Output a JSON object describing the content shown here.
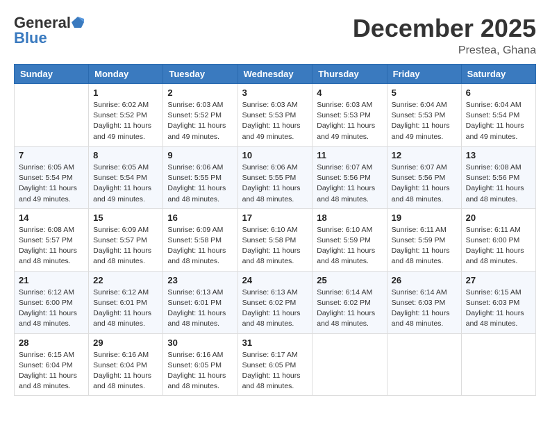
{
  "logo": {
    "general": "General",
    "blue": "Blue"
  },
  "title": "December 2025",
  "location": "Prestea, Ghana",
  "weekdays": [
    "Sunday",
    "Monday",
    "Tuesday",
    "Wednesday",
    "Thursday",
    "Friday",
    "Saturday"
  ],
  "weeks": [
    [
      {
        "day": "",
        "info": ""
      },
      {
        "day": "1",
        "info": "Sunrise: 6:02 AM\nSunset: 5:52 PM\nDaylight: 11 hours\nand 49 minutes."
      },
      {
        "day": "2",
        "info": "Sunrise: 6:03 AM\nSunset: 5:52 PM\nDaylight: 11 hours\nand 49 minutes."
      },
      {
        "day": "3",
        "info": "Sunrise: 6:03 AM\nSunset: 5:53 PM\nDaylight: 11 hours\nand 49 minutes."
      },
      {
        "day": "4",
        "info": "Sunrise: 6:03 AM\nSunset: 5:53 PM\nDaylight: 11 hours\nand 49 minutes."
      },
      {
        "day": "5",
        "info": "Sunrise: 6:04 AM\nSunset: 5:53 PM\nDaylight: 11 hours\nand 49 minutes."
      },
      {
        "day": "6",
        "info": "Sunrise: 6:04 AM\nSunset: 5:54 PM\nDaylight: 11 hours\nand 49 minutes."
      }
    ],
    [
      {
        "day": "7",
        "info": "Sunrise: 6:05 AM\nSunset: 5:54 PM\nDaylight: 11 hours\nand 49 minutes."
      },
      {
        "day": "8",
        "info": "Sunrise: 6:05 AM\nSunset: 5:54 PM\nDaylight: 11 hours\nand 49 minutes."
      },
      {
        "day": "9",
        "info": "Sunrise: 6:06 AM\nSunset: 5:55 PM\nDaylight: 11 hours\nand 48 minutes."
      },
      {
        "day": "10",
        "info": "Sunrise: 6:06 AM\nSunset: 5:55 PM\nDaylight: 11 hours\nand 48 minutes."
      },
      {
        "day": "11",
        "info": "Sunrise: 6:07 AM\nSunset: 5:56 PM\nDaylight: 11 hours\nand 48 minutes."
      },
      {
        "day": "12",
        "info": "Sunrise: 6:07 AM\nSunset: 5:56 PM\nDaylight: 11 hours\nand 48 minutes."
      },
      {
        "day": "13",
        "info": "Sunrise: 6:08 AM\nSunset: 5:56 PM\nDaylight: 11 hours\nand 48 minutes."
      }
    ],
    [
      {
        "day": "14",
        "info": "Sunrise: 6:08 AM\nSunset: 5:57 PM\nDaylight: 11 hours\nand 48 minutes."
      },
      {
        "day": "15",
        "info": "Sunrise: 6:09 AM\nSunset: 5:57 PM\nDaylight: 11 hours\nand 48 minutes."
      },
      {
        "day": "16",
        "info": "Sunrise: 6:09 AM\nSunset: 5:58 PM\nDaylight: 11 hours\nand 48 minutes."
      },
      {
        "day": "17",
        "info": "Sunrise: 6:10 AM\nSunset: 5:58 PM\nDaylight: 11 hours\nand 48 minutes."
      },
      {
        "day": "18",
        "info": "Sunrise: 6:10 AM\nSunset: 5:59 PM\nDaylight: 11 hours\nand 48 minutes."
      },
      {
        "day": "19",
        "info": "Sunrise: 6:11 AM\nSunset: 5:59 PM\nDaylight: 11 hours\nand 48 minutes."
      },
      {
        "day": "20",
        "info": "Sunrise: 6:11 AM\nSunset: 6:00 PM\nDaylight: 11 hours\nand 48 minutes."
      }
    ],
    [
      {
        "day": "21",
        "info": "Sunrise: 6:12 AM\nSunset: 6:00 PM\nDaylight: 11 hours\nand 48 minutes."
      },
      {
        "day": "22",
        "info": "Sunrise: 6:12 AM\nSunset: 6:01 PM\nDaylight: 11 hours\nand 48 minutes."
      },
      {
        "day": "23",
        "info": "Sunrise: 6:13 AM\nSunset: 6:01 PM\nDaylight: 11 hours\nand 48 minutes."
      },
      {
        "day": "24",
        "info": "Sunrise: 6:13 AM\nSunset: 6:02 PM\nDaylight: 11 hours\nand 48 minutes."
      },
      {
        "day": "25",
        "info": "Sunrise: 6:14 AM\nSunset: 6:02 PM\nDaylight: 11 hours\nand 48 minutes."
      },
      {
        "day": "26",
        "info": "Sunrise: 6:14 AM\nSunset: 6:03 PM\nDaylight: 11 hours\nand 48 minutes."
      },
      {
        "day": "27",
        "info": "Sunrise: 6:15 AM\nSunset: 6:03 PM\nDaylight: 11 hours\nand 48 minutes."
      }
    ],
    [
      {
        "day": "28",
        "info": "Sunrise: 6:15 AM\nSunset: 6:04 PM\nDaylight: 11 hours\nand 48 minutes."
      },
      {
        "day": "29",
        "info": "Sunrise: 6:16 AM\nSunset: 6:04 PM\nDaylight: 11 hours\nand 48 minutes."
      },
      {
        "day": "30",
        "info": "Sunrise: 6:16 AM\nSunset: 6:05 PM\nDaylight: 11 hours\nand 48 minutes."
      },
      {
        "day": "31",
        "info": "Sunrise: 6:17 AM\nSunset: 6:05 PM\nDaylight: 11 hours\nand 48 minutes."
      },
      {
        "day": "",
        "info": ""
      },
      {
        "day": "",
        "info": ""
      },
      {
        "day": "",
        "info": ""
      }
    ]
  ]
}
